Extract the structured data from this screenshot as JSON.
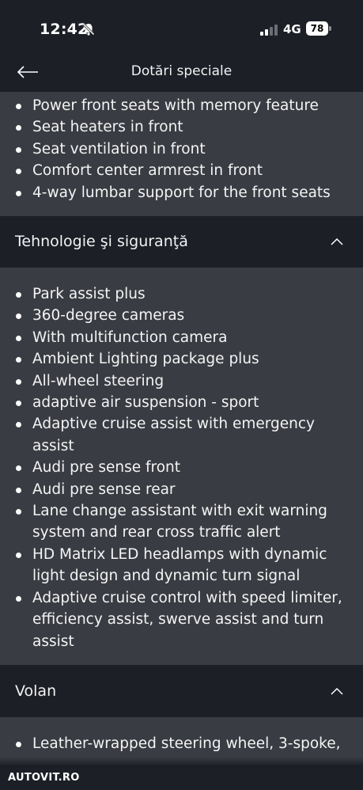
{
  "status_bar": {
    "time": "12:42",
    "network": "4G",
    "battery": "78"
  },
  "header": {
    "title": "Dotări speciale"
  },
  "sections": [
    {
      "title": "",
      "items": [
        "Power front seats with memory feature",
        "Seat heaters in front",
        "Seat ventilation in front",
        "Comfort center armrest in front",
        "4-way lumbar support for the front seats"
      ]
    },
    {
      "title": "Tehnologie şi siguranţă",
      "items": [
        "Park assist plus",
        "360-degree cameras",
        "With multifunction camera",
        "Ambient Lighting package plus",
        "All-wheel steering",
        "adaptive air suspension - sport",
        "Adaptive cruise assist with emergency assist",
        "Audi pre sense front",
        "Audi pre sense rear",
        "Lane change assistant with exit warning system and rear cross traffic alert",
        "HD Matrix LED headlamps with dynamic light design and dynamic turn signal",
        "Adaptive cruise control with speed limiter, efficiency assist, swerve assist and turn assist"
      ]
    },
    {
      "title": "Volan",
      "items": [
        "Leather-wrapped steering wheel, 3-spoke,"
      ]
    }
  ],
  "watermark": "AUTOVIT.RO",
  "icons": {
    "back": "arrow-left-icon",
    "mute": "bell-slash-icon",
    "signal": "cellular-signal-icon",
    "collapse": "chevron-up-icon"
  },
  "colors": {
    "background": "#1c1f26",
    "panel": "#3a3c43",
    "text": "#ffffff"
  }
}
